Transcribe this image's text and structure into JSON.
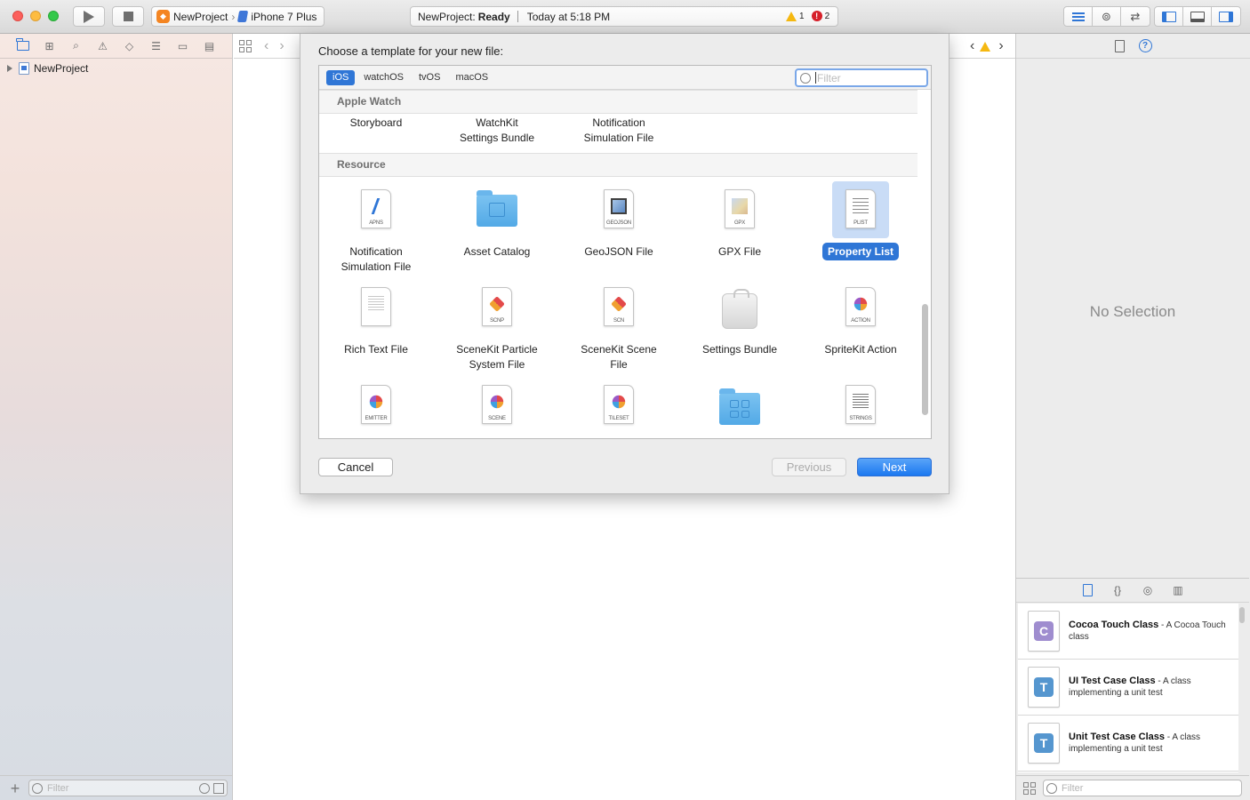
{
  "toolbar": {
    "scheme_app": "NewProject",
    "scheme_device": "iPhone 7 Plus",
    "activity_project": "NewProject:",
    "activity_status": "Ready",
    "activity_time": "Today at 5:18 PM",
    "warning_count": "1",
    "error_count": "2"
  },
  "navigator": {
    "project_name": "NewProject",
    "filter_placeholder": "Filter"
  },
  "inspector": {
    "empty_text": "No Selection",
    "library_items": [
      {
        "name": "Cocoa Touch Class",
        "desc": " - A Cocoa Touch class",
        "letter": "C"
      },
      {
        "name": "UI Test Case Class",
        "desc": " - A class implementing a unit test",
        "letter": "T"
      },
      {
        "name": "Unit Test Case Class",
        "desc": " - A class implementing a unit test",
        "letter": "T"
      }
    ],
    "filter_placeholder": "Filter"
  },
  "dialog": {
    "title": "Choose a template for your new file:",
    "platforms": [
      "iOS",
      "watchOS",
      "tvOS",
      "macOS"
    ],
    "selected_platform": "iOS",
    "filter_placeholder": "Filter",
    "sections": {
      "apple_watch": {
        "title": "Apple Watch",
        "items": [
          {
            "line1": "Storyboard",
            "line2": ""
          },
          {
            "line1": "WatchKit",
            "line2": "Settings Bundle"
          },
          {
            "line1": "Notification",
            "line2": "Simulation File"
          }
        ]
      },
      "resource": {
        "title": "Resource",
        "items": [
          {
            "line1": "Notification",
            "line2": "Simulation File",
            "tag": "APNS"
          },
          {
            "line1": "Asset Catalog",
            "line2": ""
          },
          {
            "line1": "GeoJSON File",
            "line2": "",
            "tag": "GEOJSON"
          },
          {
            "line1": "GPX File",
            "line2": "",
            "tag": "GPX"
          },
          {
            "line1": "Property List",
            "line2": "",
            "tag": "PLIST"
          },
          {
            "line1": "Rich Text File",
            "line2": ""
          },
          {
            "line1": "SceneKit Particle",
            "line2": "System File",
            "tag": "SCNP"
          },
          {
            "line1": "SceneKit Scene",
            "line2": "File",
            "tag": "SCN"
          },
          {
            "line1": "Settings Bundle",
            "line2": ""
          },
          {
            "line1": "SpriteKit Action",
            "line2": "",
            "tag": "ACTION"
          },
          {
            "tag": "EMITTER"
          },
          {
            "tag": "SCENE"
          },
          {
            "tag": "TILESET"
          },
          {},
          {
            "tag": "STRINGS"
          }
        ]
      }
    },
    "selected_item": "Property List",
    "buttons": {
      "cancel": "Cancel",
      "previous": "Previous",
      "next": "Next"
    }
  },
  "colors": {
    "accent": "#2f76d6",
    "warning": "#f5b811",
    "error": "#d6202a"
  }
}
